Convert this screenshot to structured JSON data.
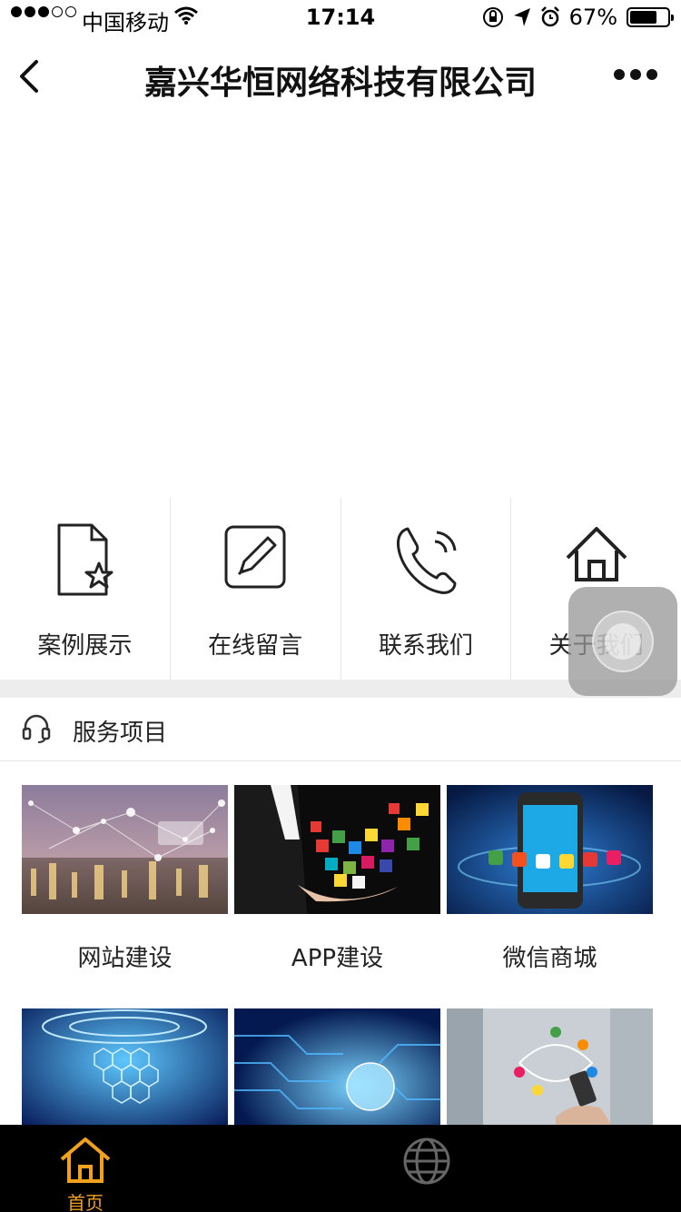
{
  "status_bar": {
    "carrier": "中国移动",
    "time": "17:14",
    "battery": "67%"
  },
  "nav": {
    "title": "嘉兴华恒网络科技有限公司"
  },
  "quick_menu": [
    {
      "label": "案例展示",
      "icon": "document-star-icon"
    },
    {
      "label": "在线留言",
      "icon": "edit-icon"
    },
    {
      "label": "联系我们",
      "icon": "phone-icon"
    },
    {
      "label": "关于我们",
      "icon": "home-icon"
    }
  ],
  "section": {
    "title": "服务项目",
    "icon": "headset-icon"
  },
  "services": [
    {
      "label": "网站建设"
    },
    {
      "label": "APP建设"
    },
    {
      "label": "微信商城"
    },
    {
      "label": ""
    },
    {
      "label": ""
    },
    {
      "label": ""
    }
  ],
  "tabbar": {
    "home_label": "首页",
    "accent": "#f1a11d"
  }
}
